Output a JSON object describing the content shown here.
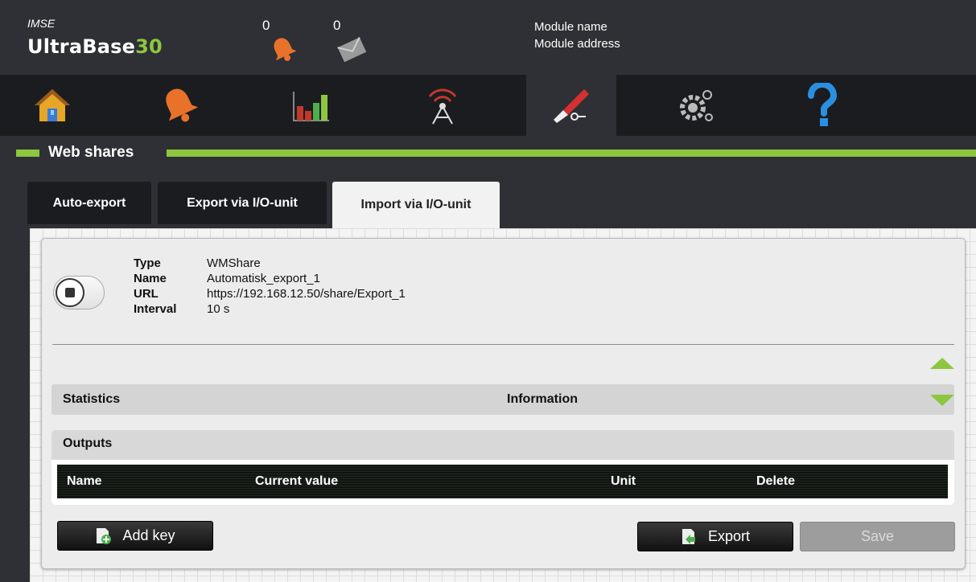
{
  "header": {
    "brand_small": "IMSE",
    "brand_main": "UltraBase",
    "brand_num": "30",
    "alarm_count": "0",
    "message_count": "0",
    "module_name_label": "Module name",
    "module_address_label": "Module address"
  },
  "nav": {
    "items": [
      "home-icon",
      "alarm-bell-icon",
      "chart-icon",
      "antenna-icon",
      "tools-icon",
      "settings-icon",
      "help-icon"
    ],
    "active": "tools-icon"
  },
  "section": {
    "title": "Web shares"
  },
  "tabs": [
    {
      "label": "Auto-export"
    },
    {
      "label": "Export via I/O-unit"
    },
    {
      "label": "Import via I/O-unit"
    }
  ],
  "share": {
    "type_label": "Type",
    "name_label": "Name",
    "url_label": "URL",
    "interval_label": "Interval",
    "type": "WMShare",
    "name": "Automatisk_export_1",
    "url": "https://192.168.12.50/share/Export_1",
    "interval": "10 s"
  },
  "stats": {
    "statistics_label": "Statistics",
    "information_label": "Information"
  },
  "outputs": {
    "title": "Outputs",
    "columns": [
      "Name",
      "Current value",
      "Unit",
      "Delete"
    ]
  },
  "buttons": {
    "add_key": "Add key",
    "export": "Export",
    "save": "Save"
  },
  "colors": {
    "accent": "#8dc63f",
    "background": "#2e3035",
    "navbar": "#1b1c20"
  }
}
